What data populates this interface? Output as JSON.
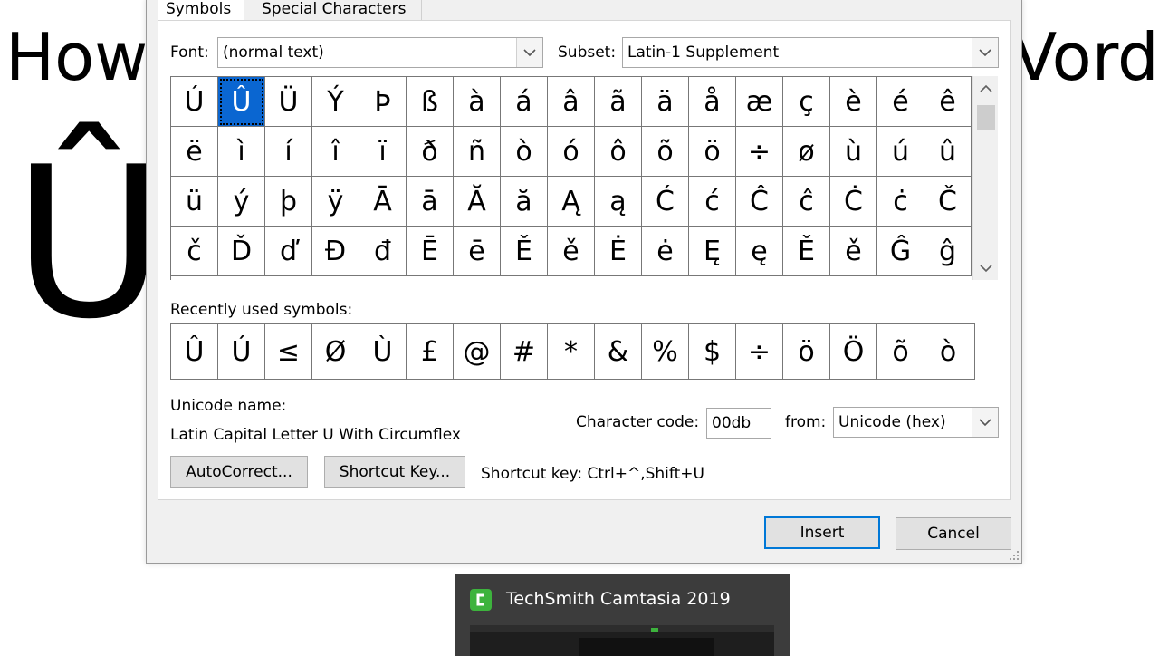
{
  "background": {
    "title_left": "How",
    "title_right": "Vord",
    "big_char": "Û"
  },
  "dialog": {
    "tabs": [
      {
        "label": "Symbols",
        "active": true
      },
      {
        "label": "Special Characters",
        "active": false
      }
    ],
    "font_label": "Font:",
    "font_value": "(normal text)",
    "subset_label": "Subset:",
    "subset_value": "Latin-1 Supplement",
    "symbol_grid": [
      [
        "Ú",
        "Û",
        "Ü",
        "Ý",
        "Þ",
        "ß",
        "à",
        "á",
        "â",
        "ã",
        "ä",
        "å",
        "æ",
        "ç",
        "è",
        "é",
        "ê"
      ],
      [
        "ë",
        "ì",
        "í",
        "î",
        "ï",
        "ð",
        "ñ",
        "ò",
        "ó",
        "ô",
        "õ",
        "ö",
        "÷",
        "ø",
        "ù",
        "ú",
        "û"
      ],
      [
        "ü",
        "ý",
        "þ",
        "ÿ",
        "Ā",
        "ā",
        "Ă",
        "ă",
        "Ą",
        "ą",
        "Ć",
        "ć",
        "Ĉ",
        "ĉ",
        "Ċ",
        "ċ",
        "Č"
      ],
      [
        "č",
        "Ď",
        "ď",
        "Đ",
        "đ",
        "Ē",
        "ē",
        "Ě",
        "ě",
        "Ė",
        "ė",
        "Ę",
        "ę",
        "Ě",
        "ě",
        "Ĝ",
        "ĝ"
      ]
    ],
    "selected_symbol": "Û",
    "recent_label": "Recently used symbols:",
    "recent_symbols": [
      "Û",
      "Ú",
      "≤",
      "Ø",
      "Ù",
      "£",
      "@",
      "#",
      "*",
      "&",
      "%",
      "$",
      "÷",
      "ö",
      "Ö",
      "õ",
      "ò"
    ],
    "unicode_name_label": "Unicode name:",
    "unicode_name_value": "Latin Capital Letter U With Circumflex",
    "char_code_label": "Character code:",
    "char_code_value": "00db",
    "from_label": "from:",
    "from_value": "Unicode (hex)",
    "autocorrect_label": "AutoCorrect...",
    "shortcut_key_button_label": "Shortcut Key...",
    "shortcut_key_text": "Shortcut key: Ctrl+^,Shift+U",
    "insert_label": "Insert",
    "cancel_label": "Cancel"
  },
  "taskbar_preview": {
    "title": "TechSmith Camtasia 2019",
    "icon": "camtasia-icon",
    "icon_color": "#3db33d"
  },
  "colors": {
    "selection": "#0a66d1",
    "default_button_border": "#0078d7"
  }
}
